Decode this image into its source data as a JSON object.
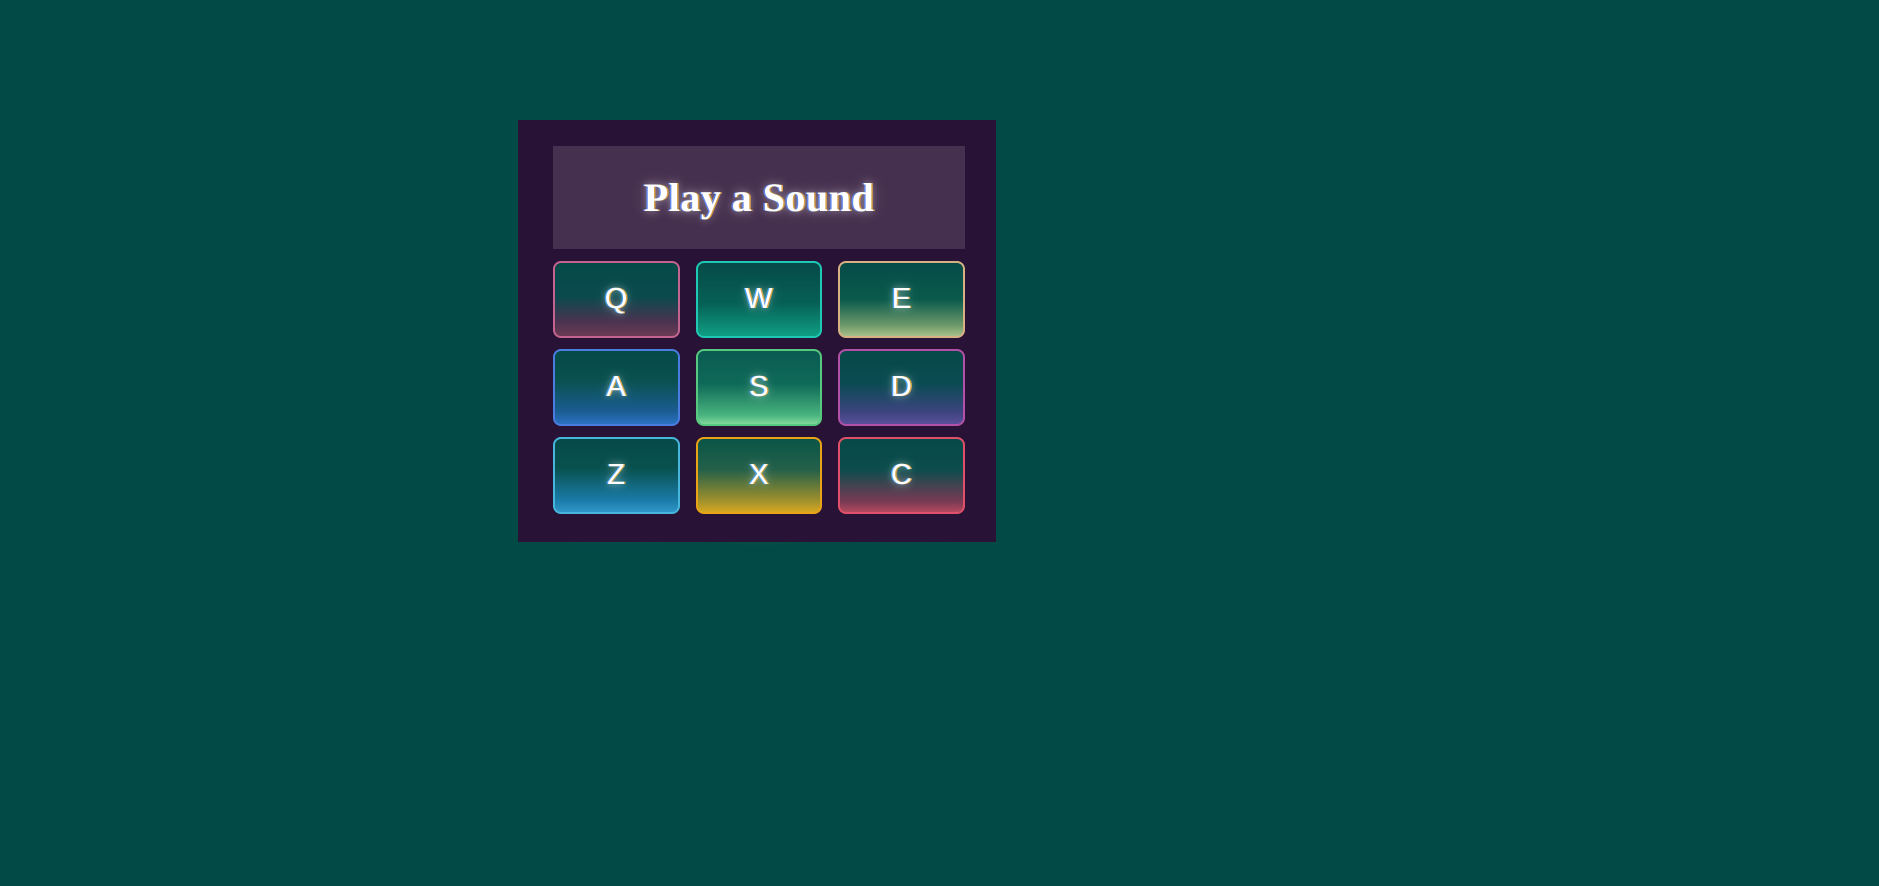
{
  "page": {
    "background_color": "#024a46"
  },
  "app": {
    "panel_color": "#281336",
    "title_bar_color": "#46304f",
    "title": "Play a Sound"
  },
  "pads": [
    {
      "label": "Q",
      "accent": "#c2648f",
      "glow": "#d6508c",
      "row": 1,
      "col": 1
    },
    {
      "label": "W",
      "accent": "#1ec8b4",
      "glow": "#1ec8b4",
      "row": 1,
      "col": 2
    },
    {
      "label": "E",
      "accent": "#d7b184",
      "glow": "#d7aa6e",
      "row": 1,
      "col": 3
    },
    {
      "label": "A",
      "accent": "#4a7de0",
      "glow": "#376eeb",
      "row": 2,
      "col": 1
    },
    {
      "label": "S",
      "accent": "#57c97e",
      "glow": "#55cd7d",
      "row": 2,
      "col": 2
    },
    {
      "label": "D",
      "accent": "#b350a8",
      "glow": "#be46af",
      "row": 2,
      "col": 3
    },
    {
      "label": "Z",
      "accent": "#46b6dc",
      "glow": "#3796e6",
      "row": 3,
      "col": 1
    },
    {
      "label": "X",
      "accent": "#e8a317",
      "glow": "#eb9619",
      "row": 3,
      "col": 2
    },
    {
      "label": "C",
      "accent": "#e0506a",
      "glow": "#e13755",
      "row": 3,
      "col": 3
    }
  ]
}
